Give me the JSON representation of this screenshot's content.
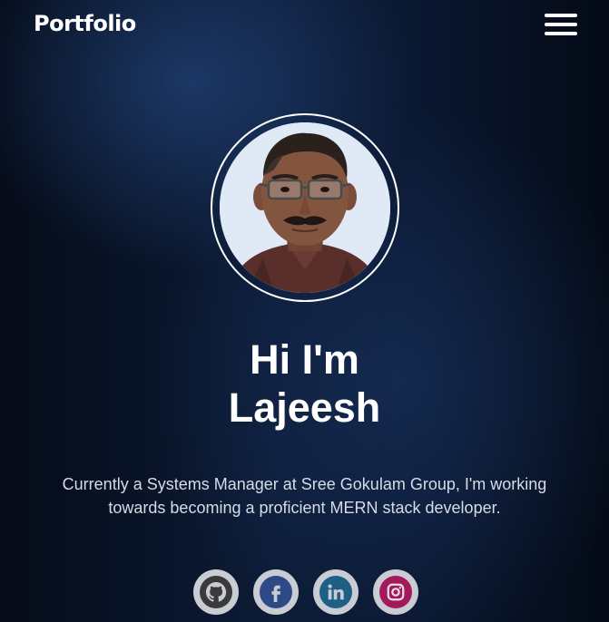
{
  "header": {
    "brand": "Portfolio",
    "menu_icon": "hamburger-menu-icon"
  },
  "hero": {
    "avatar_icon": "profile-photo",
    "greeting_line1": "Hi I'm",
    "greeting_line2": "Lajeesh",
    "bio": "Currently a Systems Manager at Sree Gokulam Group, I'm working towards becoming a proficient MERN stack developer."
  },
  "social": {
    "items": [
      {
        "icon": "github-icon",
        "color": "#3a3a3a"
      },
      {
        "icon": "facebook-icon",
        "color": "#2d4a86"
      },
      {
        "icon": "linkedin-icon",
        "color": "#1f5f86"
      },
      {
        "icon": "instagram-icon",
        "color": "#a3195b"
      }
    ]
  },
  "colors": {
    "background_dark": "#081226",
    "background_accent": "#224378",
    "text_primary": "#ffffff",
    "text_secondary": "#d6dce6",
    "social_ring": "#c9ccd3"
  }
}
